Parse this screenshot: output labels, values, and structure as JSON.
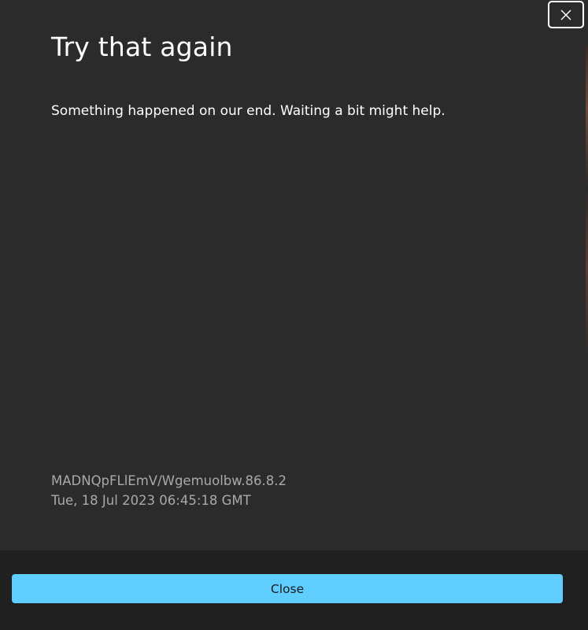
{
  "dialog": {
    "title": "Try that again",
    "message": "Something happened on our end. Waiting a bit might help.",
    "error_code": "MADNQpFLlEmV/Wgemuolbw.86.8.2",
    "timestamp": "Tue, 18 Jul 2023 06:45:18 GMT"
  },
  "footer": {
    "close_label": "Close"
  },
  "icons": {
    "dismiss": "close-icon"
  },
  "colors": {
    "background": "#2b2b2b",
    "footer_background": "#202020",
    "accent": "#60cdff",
    "secondary_text": "#a9a9a9"
  }
}
